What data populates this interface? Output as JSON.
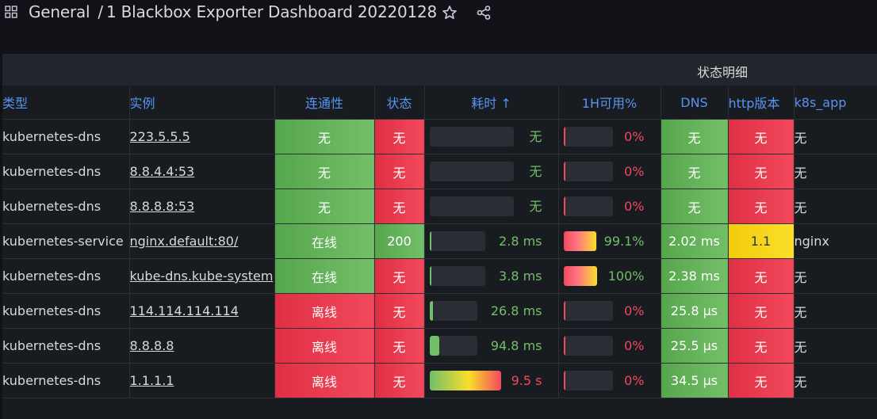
{
  "breadcrumb": {
    "root": "General",
    "separator": "/",
    "dashboard": "1 Blackbox Exporter Dashboard 20220128"
  },
  "panel": {
    "group_header": "状态明细",
    "columns": [
      "类型",
      "实例",
      "连通性",
      "状态",
      "耗时 ↑",
      "1H可用%",
      "DNS",
      "http版本",
      "k8s_app"
    ],
    "rows": [
      {
        "type": "kubernetes-dns",
        "instance": "223.5.5.5",
        "conn": "无",
        "conn_color": "green",
        "status": "无",
        "status_color": "red",
        "duration": "无",
        "dur_frac": 0,
        "avail": "0%",
        "avail_frac": 0,
        "dns": "无",
        "dns_color": "green",
        "http": "无",
        "http_color": "red",
        "k8s": "无"
      },
      {
        "type": "kubernetes-dns",
        "instance": "8.8.4.4:53",
        "conn": "无",
        "conn_color": "green",
        "status": "无",
        "status_color": "red",
        "duration": "无",
        "dur_frac": 0,
        "avail": "0%",
        "avail_frac": 0,
        "dns": "无",
        "dns_color": "green",
        "http": "无",
        "http_color": "red",
        "k8s": "无"
      },
      {
        "type": "kubernetes-dns",
        "instance": "8.8.8.8:53",
        "conn": "无",
        "conn_color": "green",
        "status": "无",
        "status_color": "red",
        "duration": "无",
        "dur_frac": 0,
        "avail": "0%",
        "avail_frac": 0,
        "dns": "无",
        "dns_color": "green",
        "http": "无",
        "http_color": "red",
        "k8s": "无"
      },
      {
        "type": "kubernetes-service",
        "instance": "nginx.default:80/",
        "conn": "在线",
        "conn_color": "green",
        "status": "200",
        "status_color": "green",
        "duration": "2.8 ms",
        "dur_frac": 0.01,
        "avail": "99.1%",
        "avail_frac": 0.991,
        "dns": "2.02 ms",
        "dns_color": "green",
        "http": "1.1",
        "http_color": "yellow",
        "k8s": "nginx"
      },
      {
        "type": "kubernetes-dns",
        "instance": "kube-dns.kube-system",
        "conn": "在线",
        "conn_color": "green",
        "status": "无",
        "status_color": "red",
        "duration": "3.8 ms",
        "dur_frac": 0.01,
        "avail": "100%",
        "avail_frac": 1.0,
        "dns": "2.38 ms",
        "dns_color": "green",
        "http": "无",
        "http_color": "red",
        "k8s": "无"
      },
      {
        "type": "kubernetes-dns",
        "instance": "114.114.114.114",
        "conn": "离线",
        "conn_color": "red",
        "status": "无",
        "status_color": "red",
        "duration": "26.8 ms",
        "dur_frac": 0.05,
        "avail": "0%",
        "avail_frac": 0,
        "dns": "25.8 µs",
        "dns_color": "green",
        "http": "无",
        "http_color": "red",
        "k8s": "无"
      },
      {
        "type": "kubernetes-dns",
        "instance": "8.8.8.8",
        "conn": "离线",
        "conn_color": "red",
        "status": "无",
        "status_color": "red",
        "duration": "94.8 ms",
        "dur_frac": 0.18,
        "avail": "0%",
        "avail_frac": 0,
        "dns": "25.5 µs",
        "dns_color": "green",
        "http": "无",
        "http_color": "red",
        "k8s": "无"
      },
      {
        "type": "kubernetes-dns",
        "instance": "1.1.1.1",
        "conn": "离线",
        "conn_color": "red",
        "status": "无",
        "status_color": "red",
        "duration": "9.5 s",
        "dur_frac": 1.0,
        "avail": "0%",
        "avail_frac": 0,
        "dns": "34.5 µs",
        "dns_color": "green",
        "http": "无",
        "http_color": "red",
        "k8s": "无"
      }
    ]
  },
  "colors": {
    "green": "#73bf69",
    "red": "#f2495c",
    "yellow": "#fade2a",
    "header": "#5794f2"
  }
}
